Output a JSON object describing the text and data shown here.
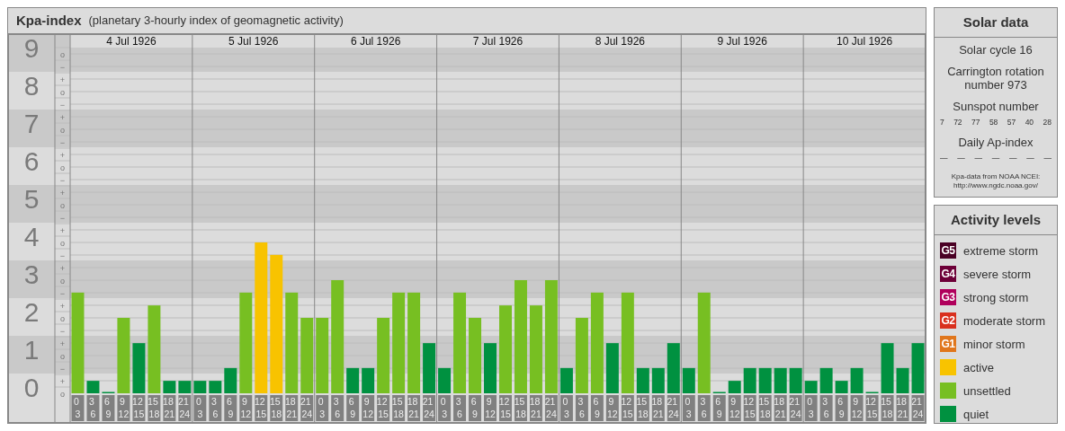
{
  "kp_panel": {
    "title": "Kpa-index",
    "subtitle": "(planetary 3-hourly index of geomagnetic activity)",
    "days": [
      "4 Jul 1926",
      "5 Jul 1926",
      "6 Jul 1926",
      "7 Jul 1926",
      "8 Jul 1926",
      "9 Jul 1926",
      "10 Jul 1926"
    ],
    "kp_marks": [
      "o",
      "−",
      "+",
      "o",
      "−",
      "+",
      "o",
      "−",
      "+",
      "o",
      "−",
      "+",
      "o",
      "−",
      "+",
      "o",
      "−",
      "+",
      "o",
      "−",
      "+",
      "o",
      "−",
      "+",
      "o",
      "−",
      "+",
      "o"
    ],
    "chart_data": {
      "type": "bar",
      "ylim": [
        0,
        9
      ],
      "grid": true,
      "yticks": [
        {
          "value": 0,
          "label": "0"
        },
        {
          "value": 1,
          "label": "1"
        },
        {
          "value": 2,
          "label": "2"
        },
        {
          "value": 3,
          "label": "3"
        },
        {
          "value": 4,
          "label": "4"
        },
        {
          "value": 5,
          "label": "5"
        },
        {
          "value": 6,
          "label": "6"
        },
        {
          "value": 7,
          "label": "7"
        },
        {
          "value": 8,
          "label": "8"
        },
        {
          "value": 9,
          "label": "9"
        }
      ],
      "categories": [
        "0 3",
        "3 6",
        "6 9",
        "9 12",
        "12 15",
        "15 18",
        "18 21",
        "21 24",
        "0 3",
        "3 6",
        "6 9",
        "9 12",
        "12 15",
        "15 18",
        "18 21",
        "21 24",
        "0 3",
        "3 6",
        "6 9",
        "9 12",
        "12 15",
        "15 18",
        "18 21",
        "21 24",
        "0 3",
        "3 6",
        "6 9",
        "9 12",
        "12 15",
        "15 18",
        "18 21",
        "21 24",
        "0 3",
        "3 6",
        "6 9",
        "9 12",
        "12 15",
        "15 18",
        "18 21",
        "21 24",
        "0 3",
        "3 6",
        "6 9",
        "9 12",
        "12 15",
        "15 18",
        "18 21",
        "21 24",
        "0 3",
        "3 6",
        "6 9",
        "9 12",
        "12 15",
        "15 18",
        "18 21",
        "21 24"
      ],
      "series": [
        {
          "color": "#009140",
          "values": [
            null,
            0.33,
            0,
            null,
            1.33,
            null,
            0.33,
            0.33,
            0.33,
            0.33,
            0.67,
            null,
            null,
            null,
            null,
            null,
            null,
            null,
            0.67,
            0.67,
            null,
            null,
            null,
            1.33,
            0.67,
            null,
            null,
            1.33,
            null,
            null,
            null,
            null,
            0.67,
            null,
            null,
            1.33,
            null,
            0.67,
            0.67,
            1.33,
            0.67,
            null,
            0,
            0.33,
            0.67,
            0.67,
            0.67,
            0.67,
            0.33,
            0.67,
            0.33,
            0.67,
            0,
            1.33,
            0.67,
            1.33
          ]
        },
        {
          "color": "#77bf22",
          "values": [
            2.67,
            null,
            null,
            2,
            null,
            2.33,
            null,
            null,
            null,
            null,
            null,
            2.67,
            null,
            null,
            2.67,
            2,
            2,
            3,
            null,
            null,
            2,
            2.67,
            2.67,
            null,
            null,
            2.67,
            2,
            null,
            2.33,
            3,
            2.33,
            3,
            null,
            2,
            2.67,
            null,
            2.67,
            null,
            null,
            null,
            null,
            2.67,
            null,
            null,
            null,
            null,
            null,
            null,
            null,
            null,
            null,
            null,
            null,
            null,
            null,
            null
          ]
        },
        {
          "color": "#f8c300",
          "values": [
            null,
            null,
            null,
            null,
            null,
            null,
            null,
            null,
            null,
            null,
            null,
            null,
            4,
            3.67,
            null,
            null,
            null,
            null,
            null,
            null,
            null,
            null,
            null,
            null,
            null,
            null,
            null,
            null,
            null,
            null,
            null,
            null,
            null,
            null,
            null,
            null,
            null,
            null,
            null,
            null,
            null,
            null,
            null,
            null,
            null,
            null,
            null,
            null,
            null,
            null,
            null,
            null,
            null,
            null,
            null,
            null
          ]
        }
      ]
    }
  },
  "solar_data": {
    "title": "Solar data",
    "solar_cycle": "Solar cycle 16",
    "carrington": "Carrington rotation number 973",
    "sunspot_label": "Sunspot number",
    "sunspot_numbers": [
      "7",
      "72",
      "77",
      "58",
      "57",
      "40",
      "28"
    ],
    "ap_label": "Daily Ap-index",
    "ap_values": [
      "—",
      "—",
      "—",
      "—",
      "—",
      "—",
      "—"
    ],
    "source": "Kpa-data from NOAA NCEI:",
    "source_url": "http://www.ngdc.noaa.gov/"
  },
  "activity_levels": {
    "title": "Activity levels",
    "items": [
      {
        "code": "G5",
        "label": "extreme storm",
        "color": "#4a0024"
      },
      {
        "code": "G4",
        "label": "severe storm",
        "color": "#6d0038"
      },
      {
        "code": "G3",
        "label": "strong storm",
        "color": "#b0005c"
      },
      {
        "code": "G2",
        "label": "moderate storm",
        "color": "#d9301e"
      },
      {
        "code": "G1",
        "label": "minor storm",
        "color": "#e0761c"
      },
      {
        "label": "active",
        "color": "#f8c300"
      },
      {
        "label": "unsettled",
        "color": "#77bf22"
      },
      {
        "label": "quiet",
        "color": "#009140"
      }
    ]
  }
}
